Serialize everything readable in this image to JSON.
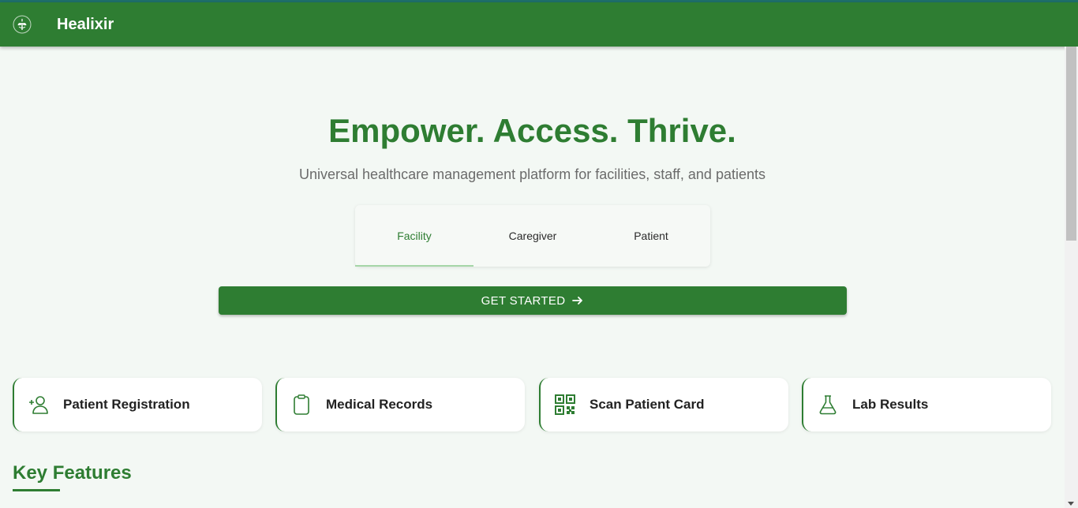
{
  "app": {
    "name": "Healixir",
    "logo_icon": "leaf-logo-icon"
  },
  "hero": {
    "title": "Empower. Access. Thrive.",
    "subtitle": "Universal healthcare management platform for facilities, staff, and patients"
  },
  "tabs": [
    {
      "label": "Facility",
      "active": true
    },
    {
      "label": "Caregiver",
      "active": false
    },
    {
      "label": "Patient",
      "active": false
    }
  ],
  "cta": {
    "label": "GET STARTED",
    "icon": "arrow-right-icon"
  },
  "quick_actions": [
    {
      "label": "Patient Registration",
      "icon": "add-person-icon"
    },
    {
      "label": "Medical Records",
      "icon": "clipboard-icon"
    },
    {
      "label": "Scan Patient Card",
      "icon": "qr-code-icon"
    },
    {
      "label": "Lab Results",
      "icon": "flask-icon"
    }
  ],
  "section": {
    "title": "Key Features"
  },
  "colors": {
    "primary": "#2e7d32",
    "background": "#f3f8f4",
    "tab_indicator": "#a5d6a7"
  }
}
